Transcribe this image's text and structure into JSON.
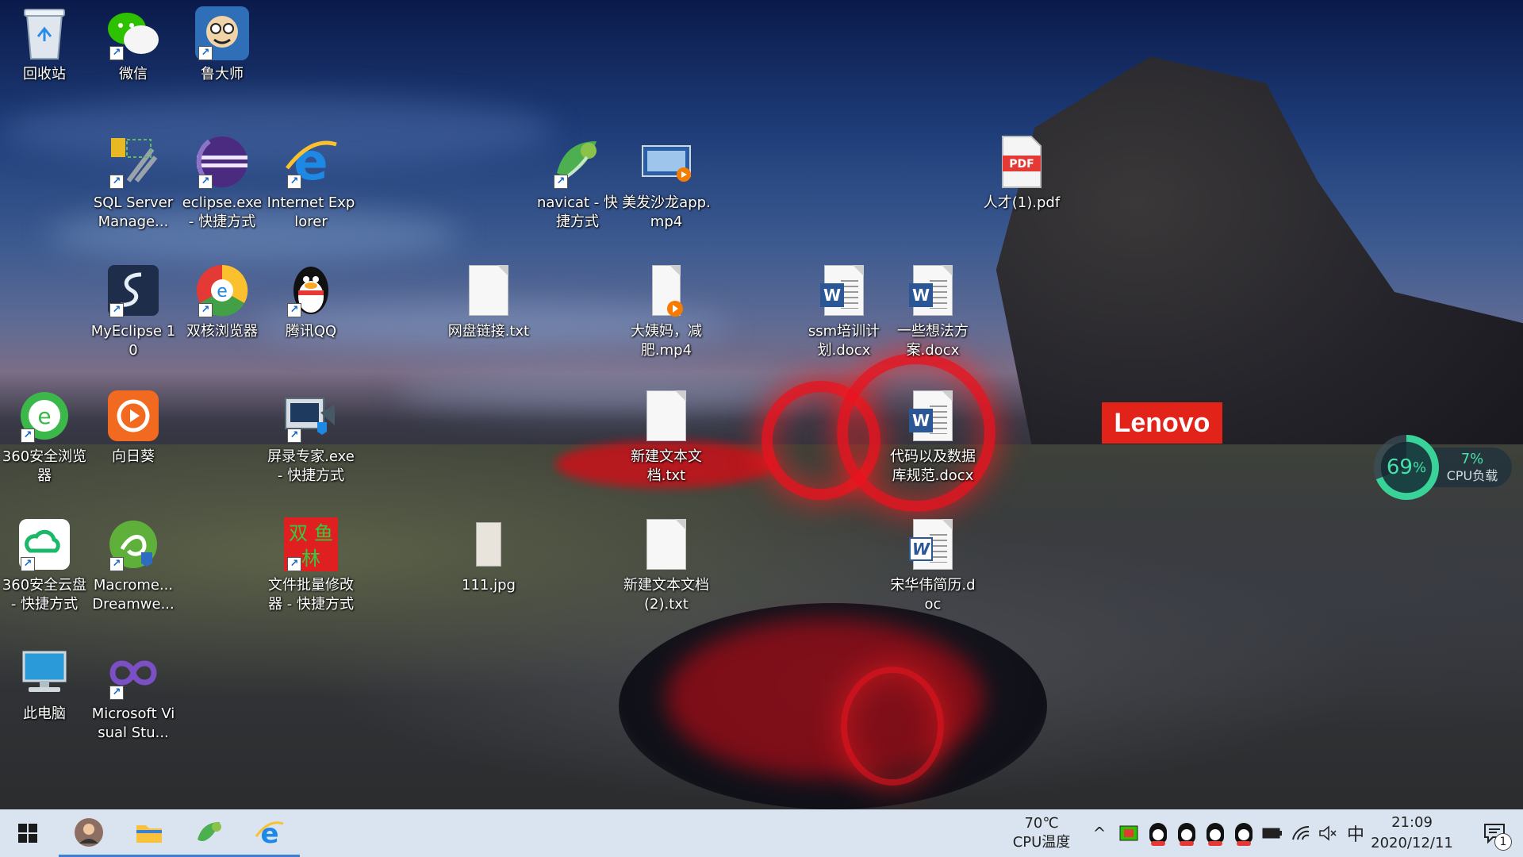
{
  "desktop": {
    "icons": [
      {
        "id": "recycle-bin",
        "label": "回收站"
      },
      {
        "id": "wechat",
        "label": "微信"
      },
      {
        "id": "ludashi",
        "label": "鲁大师"
      },
      {
        "id": "sql-server",
        "label": "SQL Server Manage..."
      },
      {
        "id": "eclipse",
        "label": "eclipse.exe - 快捷方式"
      },
      {
        "id": "ie",
        "label": "Internet Explorer"
      },
      {
        "id": "navicat",
        "label": "navicat - 快捷方式"
      },
      {
        "id": "video-salon",
        "label": "美发沙龙app.mp4"
      },
      {
        "id": "pdf",
        "label": "人才(1).pdf"
      },
      {
        "id": "myeclipse",
        "label": "MyEclipse 10"
      },
      {
        "id": "dual-browser",
        "label": "双核浏览器"
      },
      {
        "id": "qq",
        "label": "腾讯QQ"
      },
      {
        "id": "netdisk-txt",
        "label": "网盘链接.txt"
      },
      {
        "id": "video-diet",
        "label": "大姨妈，减肥.mp4"
      },
      {
        "id": "ssm-docx",
        "label": "ssm培训计划.docx"
      },
      {
        "id": "ideas-docx",
        "label": "一些想法方案.docx"
      },
      {
        "id": "360-browser",
        "label": "360安全浏览器"
      },
      {
        "id": "sunflower",
        "label": "向日葵"
      },
      {
        "id": "screen-recorder",
        "label": "屏录专家.exe - 快捷方式"
      },
      {
        "id": "new-txt",
        "label": "新建文本文档.txt"
      },
      {
        "id": "code-docx",
        "label": "代码以及数据库规范.docx"
      },
      {
        "id": "360-cloud",
        "label": "360安全云盘 - 快捷方式"
      },
      {
        "id": "dreamweaver",
        "label": "Macrome... Dreamwe..."
      },
      {
        "id": "batch-rename",
        "label": "文件批量修改器 - 快捷方式"
      },
      {
        "id": "jpg",
        "label": "111.jpg"
      },
      {
        "id": "new-txt-2",
        "label": "新建文本文档(2).txt"
      },
      {
        "id": "resume-doc",
        "label": "宋华伟简历.doc"
      },
      {
        "id": "this-pc",
        "label": "此电脑"
      },
      {
        "id": "visual-studio",
        "label": "Microsoft Visual Stu..."
      }
    ],
    "batch_rename_glyph": [
      "双",
      "鱼",
      "林"
    ],
    "lenovo_logo": "Lenovo",
    "cpu_widget": {
      "usage_percent": "69",
      "percent_sign": "%",
      "load_value": "7%",
      "load_label": "CPU负载"
    }
  },
  "taskbar": {
    "pinned": [
      "start",
      "user-avatar",
      "file-explorer",
      "navicat",
      "internet-explorer"
    ],
    "temperature": "70℃",
    "temperature_label": "CPU温度",
    "tray_ime": "中",
    "time": "21:09",
    "date": "2020/12/11",
    "notification_count": "1",
    "chevron": "^"
  },
  "colors": {
    "taskbar_bg": "#d9e4f0",
    "lenovo_red": "#e2231a",
    "cpu_green": "#46e0a8",
    "accent_blue": "#3b7fd6"
  }
}
